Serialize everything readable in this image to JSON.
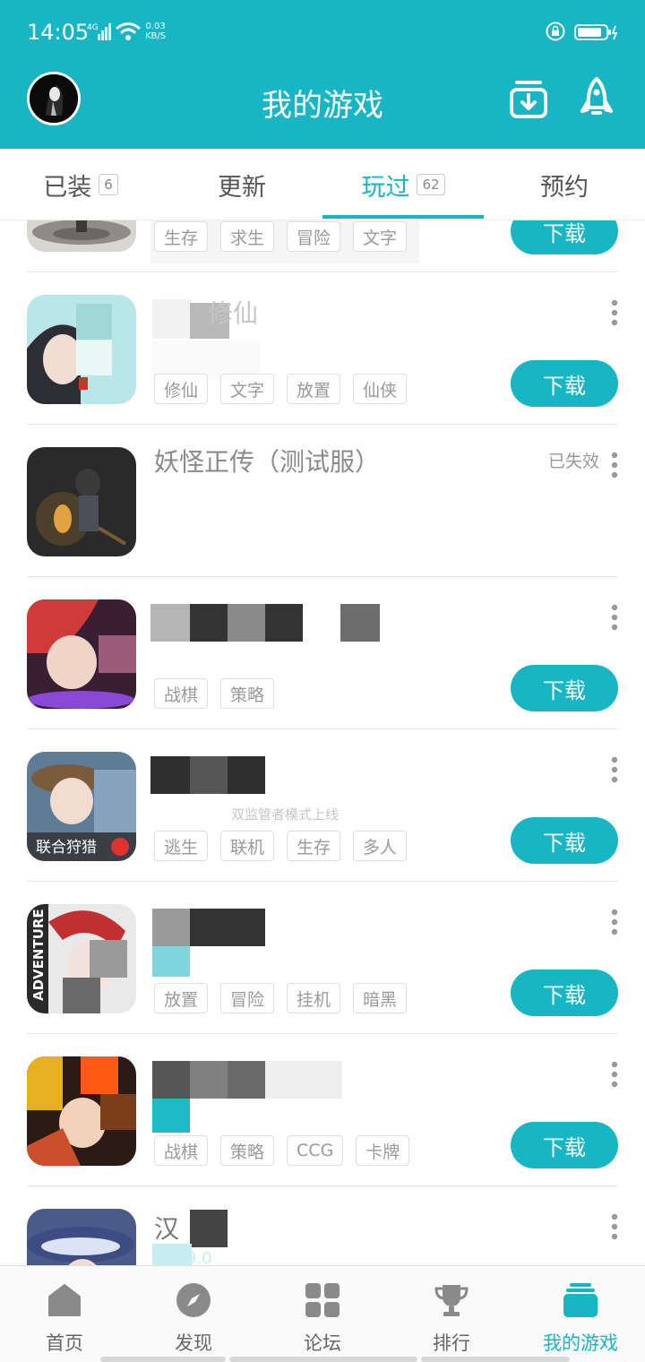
{
  "status_bar": {
    "time": "14:05",
    "network": "4G",
    "speed_value": "0.03",
    "speed_unit": "KB/S"
  },
  "header": {
    "title": "我的游戏"
  },
  "tabs": [
    {
      "label": "已装",
      "badge": "6"
    },
    {
      "label": "更新",
      "badge": ""
    },
    {
      "label": "玩过",
      "badge": "62"
    },
    {
      "label": "预约",
      "badge": ""
    }
  ],
  "active_tab": "玩过",
  "games": [
    {
      "name": "",
      "tags": [
        "生存",
        "求生",
        "冒险",
        "文字"
      ],
      "action": "下载"
    },
    {
      "name": "修仙",
      "tags": [
        "修仙",
        "文字",
        "放置",
        "仙侠"
      ],
      "action": "下载"
    },
    {
      "name": "妖怪正传（测试服）",
      "tags": [],
      "status": "已失效"
    },
    {
      "name": "",
      "tags": [
        "战棋",
        "策略"
      ],
      "action": "下载"
    },
    {
      "name": "",
      "subtitle": "双监管者模式上线",
      "icon_caption": "联合狩猎",
      "tags": [
        "逃生",
        "联机",
        "生存",
        "多人"
      ],
      "action": "下载"
    },
    {
      "name": "",
      "icon_caption": "ADVENTURE",
      "tags": [
        "放置",
        "冒险",
        "挂机",
        "暗黑"
      ],
      "action": "下载"
    },
    {
      "name": "",
      "tags": [
        "战棋",
        "策略",
        "CCG",
        "卡牌"
      ],
      "action": "下载"
    },
    {
      "name": "汉",
      "tags": [],
      "rating": "9.0"
    }
  ],
  "bottom_nav": [
    {
      "label": "首页",
      "icon": "home-icon"
    },
    {
      "label": "发现",
      "icon": "compass-icon"
    },
    {
      "label": "论坛",
      "icon": "grid-icon"
    },
    {
      "label": "排行",
      "icon": "trophy-icon"
    },
    {
      "label": "我的游戏",
      "icon": "stack-icon"
    }
  ],
  "colors": {
    "accent": "#18b6c4",
    "tag_border": "#dedede",
    "text_gray": "#8a8a8a"
  }
}
